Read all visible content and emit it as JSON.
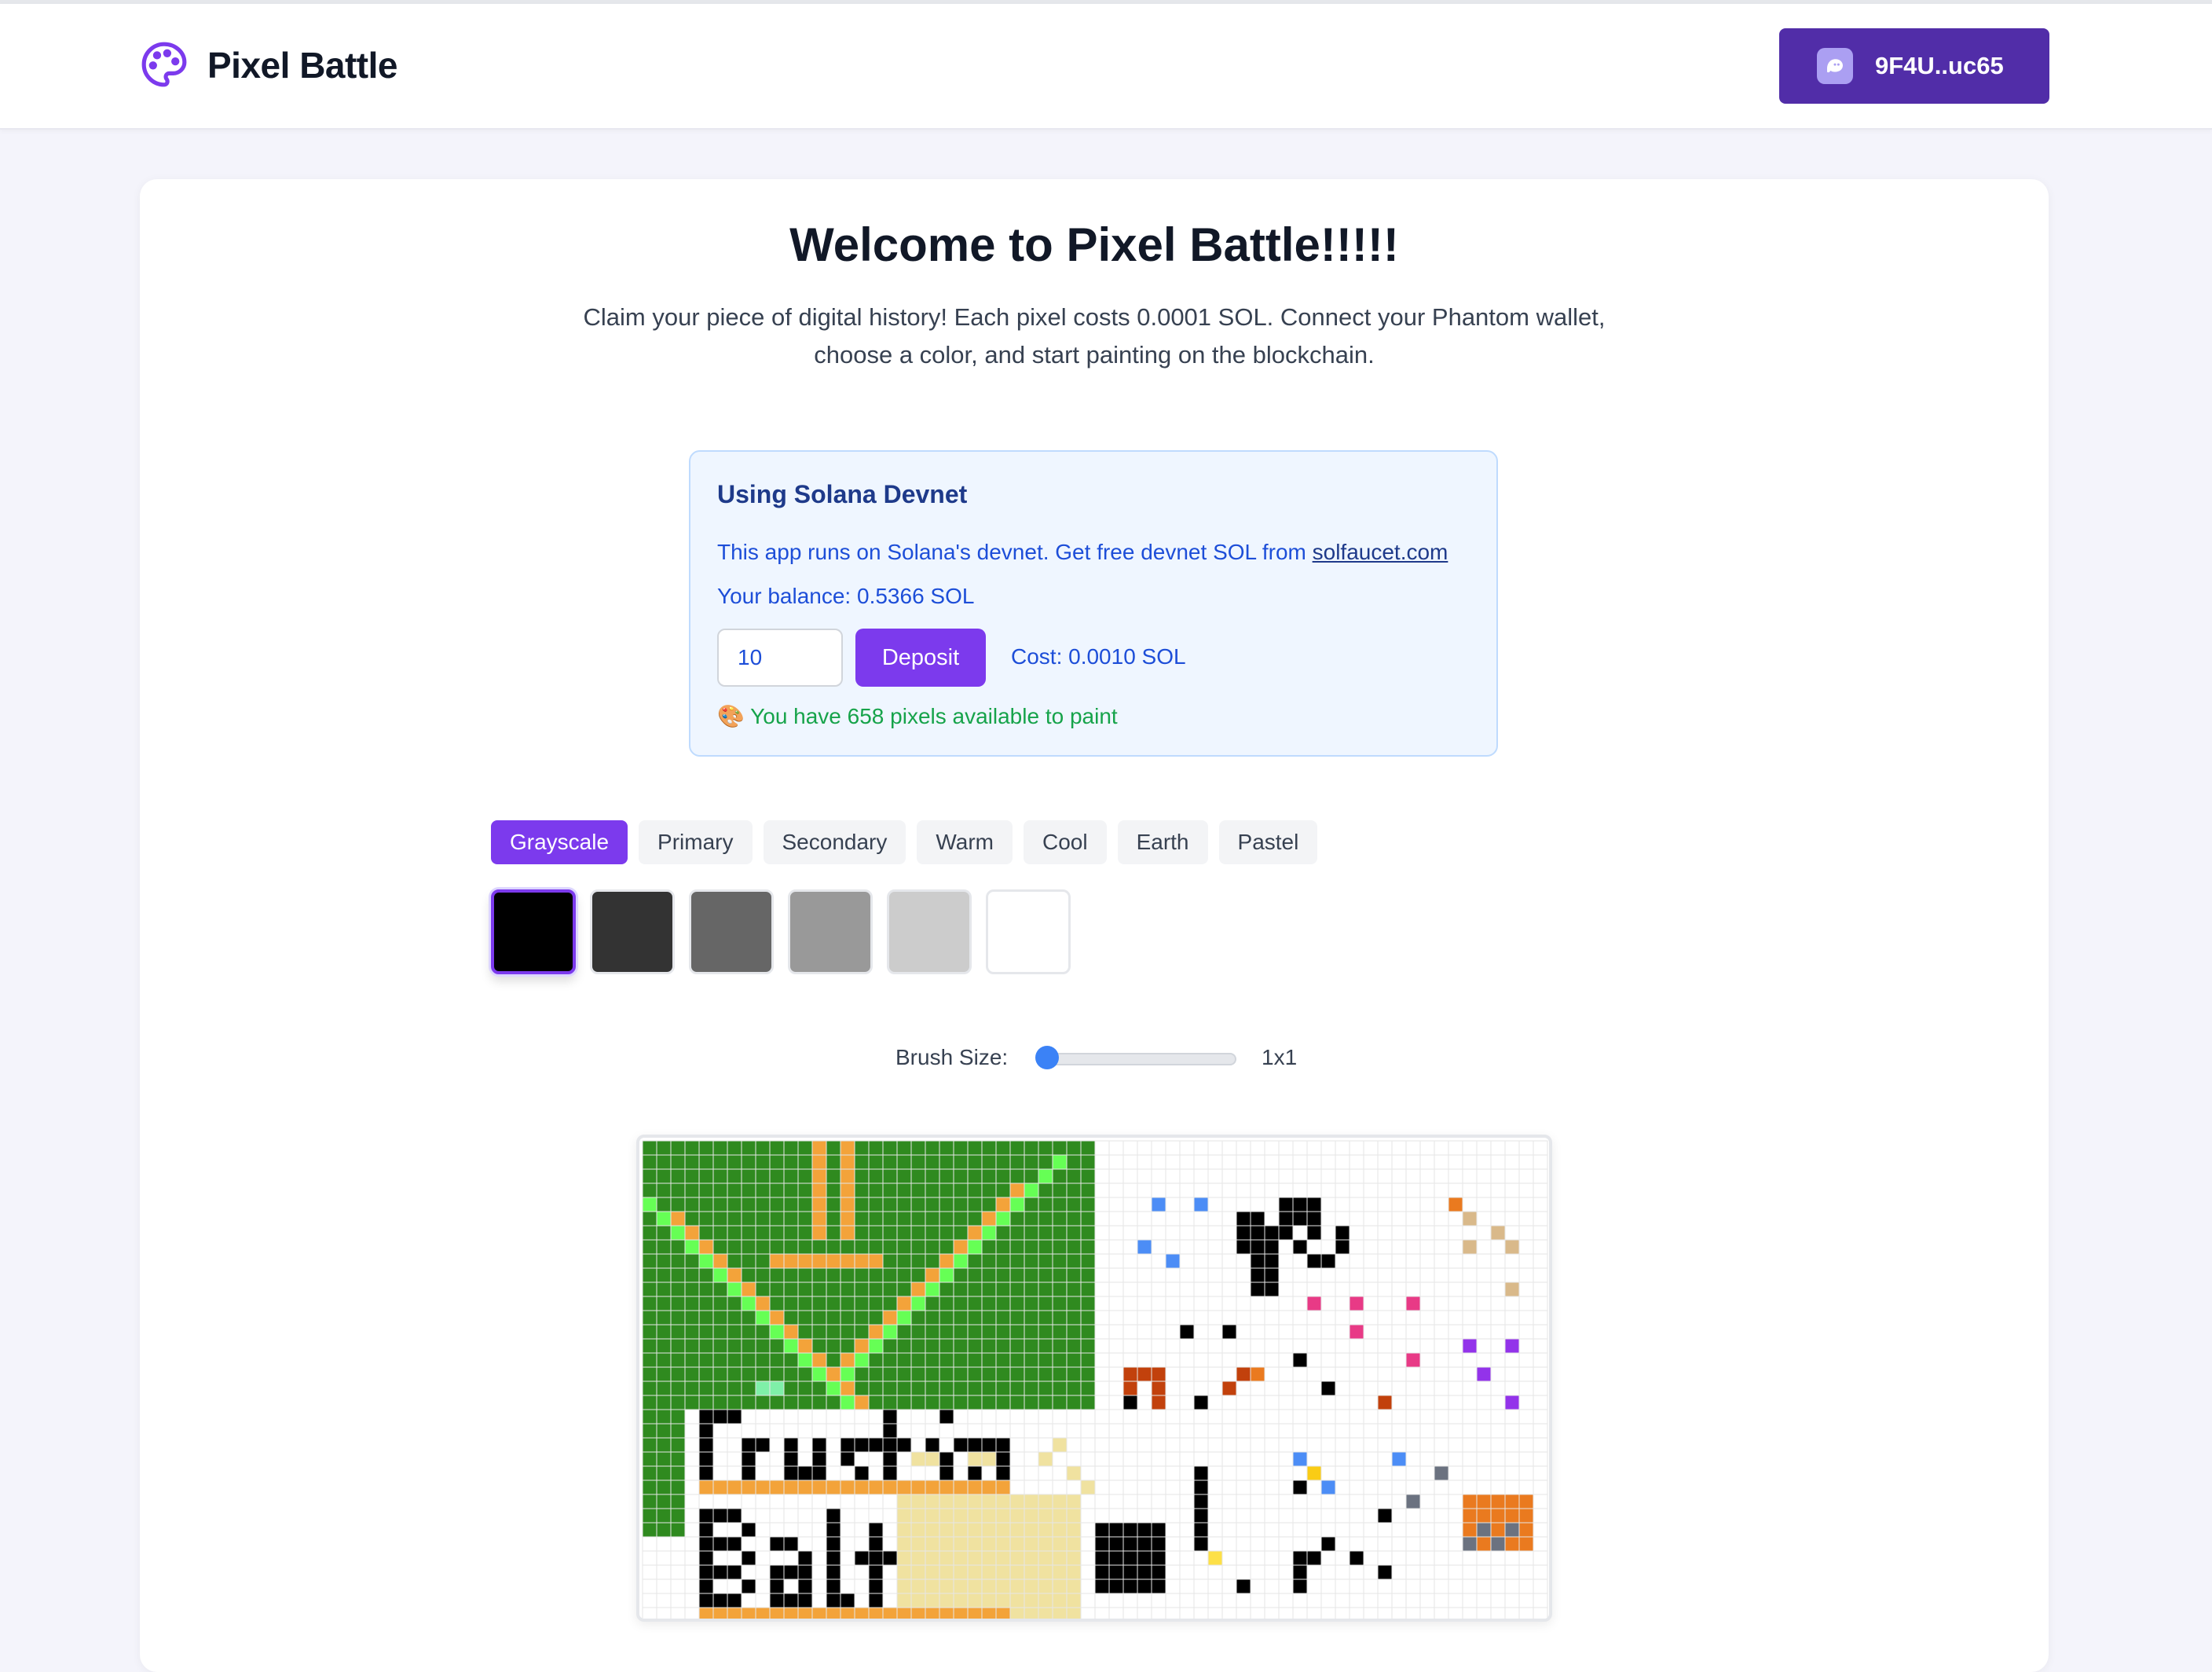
{
  "header": {
    "app_name": "Pixel Battle",
    "logo_icon": "palette-icon",
    "wallet_icon": "phantom-ghost-icon",
    "wallet_label": "9F4U..uc65"
  },
  "main": {
    "title": "Welcome to Pixel Battle!!!!!",
    "intro": "Claim your piece of digital history! Each pixel costs 0.0001 SOL. Connect your Phantom wallet, choose a color, and start painting on the blockchain."
  },
  "devnet": {
    "title": "Using Solana Devnet",
    "text_prefix": "This app runs on Solana's devnet. Get free devnet SOL from ",
    "link": "solfaucet.com",
    "balance": "Your balance: 0.5366 SOL",
    "amount_value": "10",
    "deposit_label": "Deposit",
    "cost": "Cost: 0.0010 SOL",
    "pixels_available": "🎨 You have 658 pixels available to paint"
  },
  "palette": {
    "tabs": [
      "Grayscale",
      "Primary",
      "Secondary",
      "Warm",
      "Cool",
      "Earth",
      "Pastel"
    ],
    "active_tab": "Grayscale",
    "colors": [
      "#000000",
      "#333333",
      "#666666",
      "#999999",
      "#cccccc",
      "#ffffff"
    ],
    "selected_color": "#000000"
  },
  "brush": {
    "label": "Brush Size:",
    "value_label": "1x1",
    "value": 1
  },
  "colors": {
    "accent": "#7c3aed",
    "wallet": "#512da8",
    "canvas_green": "#2f8a1f",
    "canvas_orange": "#f3a33a",
    "canvas_lime": "#66ff55",
    "canvas_yellow": "#f0e2a0"
  }
}
